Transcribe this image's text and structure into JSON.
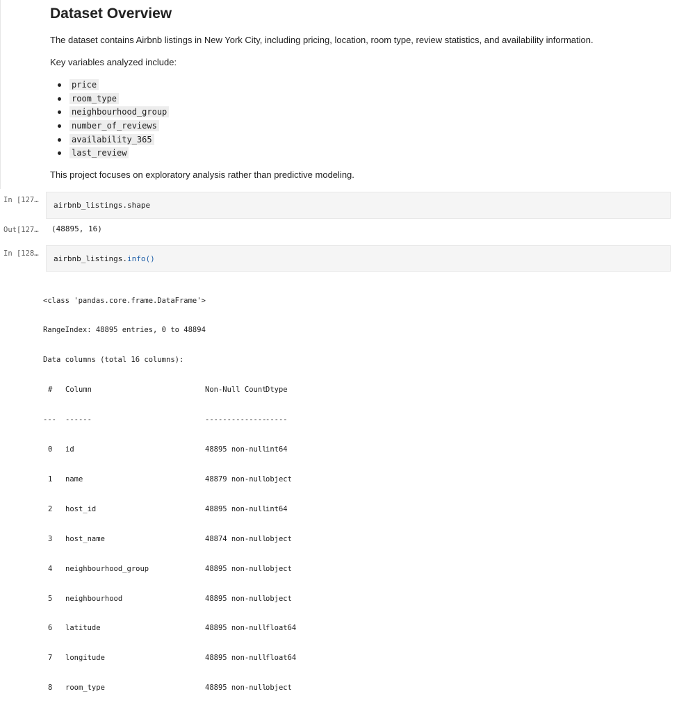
{
  "markdown": {
    "title": "Dataset Overview",
    "intro": "The dataset contains Airbnb listings in New York City, including pricing, location, room type, review statistics, and availability information.",
    "key_vars_label": "Key variables analyzed include:",
    "variables": [
      "price",
      "room_type",
      "neighbourhood_group",
      "number_of_reviews",
      "availability_365",
      "last_review"
    ],
    "focus": "This project focuses on exploratory analysis rather than predictive modeling."
  },
  "cell_shape": {
    "in_prompt": "In [127…",
    "code_obj": "airbnb_listings.",
    "code_attr": "shape",
    "out_prompt": "Out[127…",
    "output": "(48895, 16)"
  },
  "cell_info": {
    "in_prompt": "In [128…",
    "code_obj": "airbnb_listings.",
    "code_fn": "info",
    "code_parens": "()",
    "header_lines": [
      "<class 'pandas.core.frame.DataFrame'>",
      "RangeIndex: 48895 entries, 0 to 48894",
      "Data columns (total 16 columns):"
    ],
    "table_header": [
      "#",
      "Column",
      "Non-Null Count",
      "Dtype"
    ],
    "table_sep": [
      "---",
      "------",
      "--------------",
      "-----"
    ],
    "rows": [
      {
        "num": "0",
        "column": "id",
        "non_null": "48895 non-null",
        "dtype": "int64"
      },
      {
        "num": "1",
        "column": "name",
        "non_null": "48879 non-null",
        "dtype": "object"
      },
      {
        "num": "2",
        "column": "host_id",
        "non_null": "48895 non-null",
        "dtype": "int64"
      },
      {
        "num": "3",
        "column": "host_name",
        "non_null": "48874 non-null",
        "dtype": "object"
      },
      {
        "num": "4",
        "column": "neighbourhood_group",
        "non_null": "48895 non-null",
        "dtype": "object"
      },
      {
        "num": "5",
        "column": "neighbourhood",
        "non_null": "48895 non-null",
        "dtype": "object"
      },
      {
        "num": "6",
        "column": "latitude",
        "non_null": "48895 non-null",
        "dtype": "float64"
      },
      {
        "num": "7",
        "column": "longitude",
        "non_null": "48895 non-null",
        "dtype": "float64"
      },
      {
        "num": "8",
        "column": "room_type",
        "non_null": "48895 non-null",
        "dtype": "object"
      }
    ]
  },
  "colors": {
    "function_blue": "#1f5fa8",
    "code_bg": "#f5f5f5",
    "prompt_gray": "#616161"
  }
}
